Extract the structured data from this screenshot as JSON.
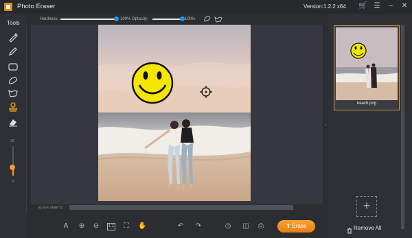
{
  "app": {
    "title": "Photo Eraser",
    "version": "Version:1.2.2 x64"
  },
  "titlebar_icons": [
    "cart-icon",
    "menu-icon",
    "minimize-icon",
    "close-icon"
  ],
  "toolbar": {
    "hardness_label": "Hardness:",
    "hardness_value": "100%",
    "hardness_level": 1.0,
    "opacity_label": "Optacity:",
    "opacity_value": "100%",
    "opacity_level": 1.0
  },
  "tools": {
    "label": "Tools",
    "items": [
      "brush-icon",
      "pencil-icon",
      "rectangle-icon",
      "lasso-icon",
      "polygon-lasso-icon",
      "stamp-icon",
      "eraser-icon"
    ],
    "active": "stamp-icon"
  },
  "brush_size": {
    "max": "30",
    "min": "0",
    "level": 0.33
  },
  "canvas": {
    "coordinates": "81.61% 748HT72"
  },
  "bottom_tools": [
    "text-size-icon",
    "zoom-in-icon",
    "zoom-out-icon",
    "actual-size-icon",
    "fit-icon",
    "hand-icon",
    "undo-icon",
    "redo-icon",
    "history-icon",
    "compare-icon",
    "print-icon"
  ],
  "erase_button": "Erase",
  "files": [
    {
      "name": "beach.png"
    }
  ],
  "remove_all": "Remove All",
  "colors": {
    "accent": "#e8901e",
    "slider_knob": "#2f8fe8",
    "background": "#2b2d31"
  }
}
